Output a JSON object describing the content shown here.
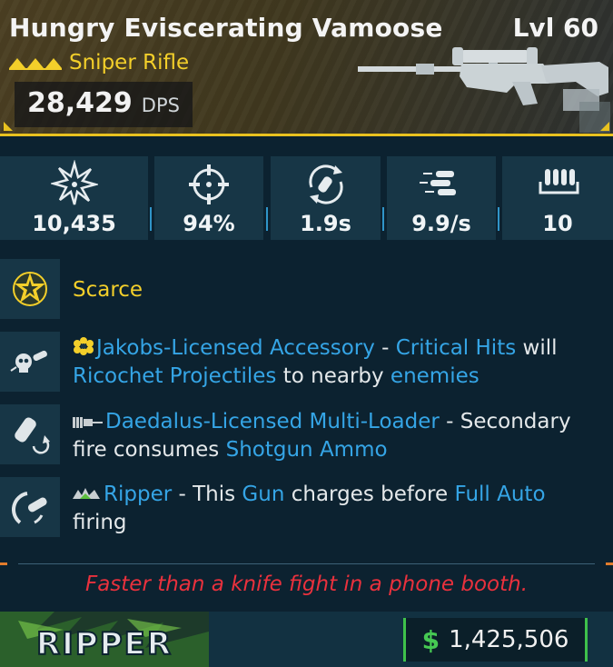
{
  "item": {
    "name": "Hungry Eviscerating Vamoose",
    "level": "Lvl 60",
    "type": "Sniper Rifle",
    "dps_value": "28,429",
    "dps_label": "DPS"
  },
  "stats": [
    {
      "icon": "damage-burst-icon",
      "value": "10,435"
    },
    {
      "icon": "accuracy-crosshair-icon",
      "value": "94%"
    },
    {
      "icon": "reload-icon",
      "value": "1.9s"
    },
    {
      "icon": "fire-rate-bullets-icon",
      "value": "9.9/s"
    },
    {
      "icon": "magazine-size-icon",
      "value": "10"
    }
  ],
  "perks": {
    "rarity": {
      "icon": "star-badge-icon",
      "label": "Scarce"
    },
    "accessory": {
      "icon": "skull-bullet-icon",
      "inline_icon": "jakobs-flower-icon",
      "title": "Jakobs-Licensed Accessory",
      "sep": " - ",
      "t1": "Critical Hits",
      "t2": " will ",
      "t3": "Ricochet Projectiles",
      "t4": " to nearby ",
      "t5": "enemies"
    },
    "loader": {
      "icon": "shotgun-shell-swap-icon",
      "inline_icon": "daedalus-barrel-icon",
      "title": "Daedalus-Licensed Multi-Loader",
      "t1": " - Secondary fire consumes ",
      "t2": "Shotgun Ammo"
    },
    "ripper": {
      "icon": "charge-shot-icon",
      "inline_icon": "ripper-logo-icon",
      "title": "Ripper",
      "t1": " - This ",
      "t2": "Gun",
      "t3": " charges before ",
      "t4": "Full Auto",
      "t5": " firing"
    }
  },
  "flavor_text": "Faster than a knife fight in a phone booth.",
  "footer": {
    "manufacturer_logo": "RIPPER",
    "currency_icon": "$",
    "price": "1,425,506"
  },
  "colors": {
    "rarity": "#f3cf2a",
    "link_blue": "#35a5e6",
    "flavor_red": "#e9313d",
    "price_green": "#46c953"
  }
}
